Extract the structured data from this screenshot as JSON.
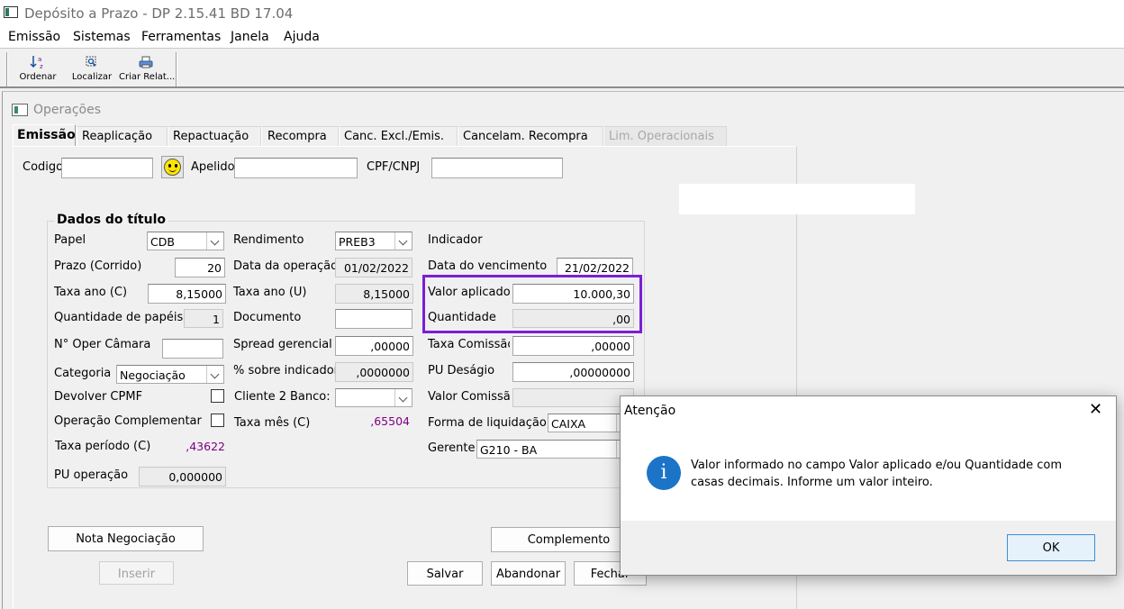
{
  "window": {
    "title": "Depósito a Prazo -  DP 2.15.41 BD 17.04"
  },
  "menu": [
    "Emissão",
    "Sistemas",
    "Ferramentas",
    "Janela",
    "Ajuda"
  ],
  "toolbar": [
    {
      "label": "Ordenar",
      "icon": "sort-icon"
    },
    {
      "label": "Localizar",
      "icon": "find-icon"
    },
    {
      "label": "Criar Relat...",
      "icon": "printer-icon"
    }
  ],
  "child": {
    "title": "Operações"
  },
  "tabs": [
    "Emissão",
    "Reaplicação",
    "Repactuação",
    "Recompra",
    "Canc. Excl./Emis.",
    "Cancelam. Recompra",
    "Lim. Operacionais"
  ],
  "header_fields": {
    "codigo_label": "Codigo",
    "codigo_value": "",
    "apelido_label": "Apelido",
    "apelido_value": "",
    "cpf_label": "CPF/CNPJ",
    "cpf_value": ""
  },
  "group": {
    "title": "Dados do título"
  },
  "col1": {
    "papel_label": "Papel",
    "papel_value": "CDB",
    "prazo_label": "Prazo (Corrido)",
    "prazo_value": "20",
    "taxa_ano_c_label": "Taxa ano (C)",
    "taxa_ano_c_value": "8,15000",
    "qtd_papeis_label": "Quantidade de papéis",
    "qtd_papeis_value": "1",
    "oper_camara_label": "N° Oper Câmara",
    "oper_camara_value": "",
    "categoria_label": "Categoria",
    "categoria_value": "Negociação",
    "devolver_label": "Devolver CPMF",
    "op_comp_label": "Operação Complementar",
    "taxa_periodo_label": "Taxa período (C)",
    "taxa_periodo_value": ",43622",
    "pu_operacao_label": "PU operação",
    "pu_operacao_value": "0,000000"
  },
  "col2": {
    "rendimento_label": "Rendimento",
    "rendimento_value": "PREB3",
    "data_op_label": "Data da operação",
    "data_op_value": "01/02/2022",
    "taxa_ano_u_label": "Taxa ano (U)",
    "taxa_ano_u_value": "8,15000",
    "documento_label": "Documento",
    "documento_value": "",
    "spread_label": "Spread gerencial",
    "spread_value": ",00000",
    "pct_indicador_label": "% sobre indicador",
    "pct_indicador_value": ",0000000",
    "cliente2_label": "Cliente 2",
    "banco_label": "Banco:",
    "banco_value": "",
    "taxa_mes_label": "Taxa mês (C)",
    "taxa_mes_value": ",65504"
  },
  "col3": {
    "indicador_label": "Indicador",
    "data_venc_label": "Data do vencimento",
    "data_venc_value": "21/02/2022",
    "valor_aplicado_label": "Valor aplicado",
    "valor_aplicado_value": "10.000,30",
    "quantidade_label": "Quantidade",
    "quantidade_value": ",00",
    "taxa_comissao_label": "Taxa Comissão",
    "taxa_comissao_value": ",00000",
    "pu_desagio_label": "PU Deságio",
    "pu_desagio_value": ",00000000",
    "valor_comissao_label": "Valor Comissão",
    "valor_comissao_value": "",
    "forma_liq_label": "Forma de liquidação",
    "forma_liq_value": "CAIXA",
    "gerente_label": "Gerente",
    "gerente_value": "G210 - BA"
  },
  "buttons": {
    "nota": "Nota Negociação",
    "inserir": "Inserir",
    "complemento": "Complemento",
    "salvar": "Salvar",
    "abandonar": "Abandonar",
    "fechar": "Fechar"
  },
  "dialog": {
    "title": "Atenção",
    "message": "Valor informado no campo Valor aplicado e/ou Quantidade com casas decimais. Informe um valor inteiro.",
    "ok": "OK",
    "icon": "info-icon"
  },
  "colors": {
    "highlight": "#7a1fd6",
    "info": "#1b74c8",
    "value_text": "#800080"
  }
}
